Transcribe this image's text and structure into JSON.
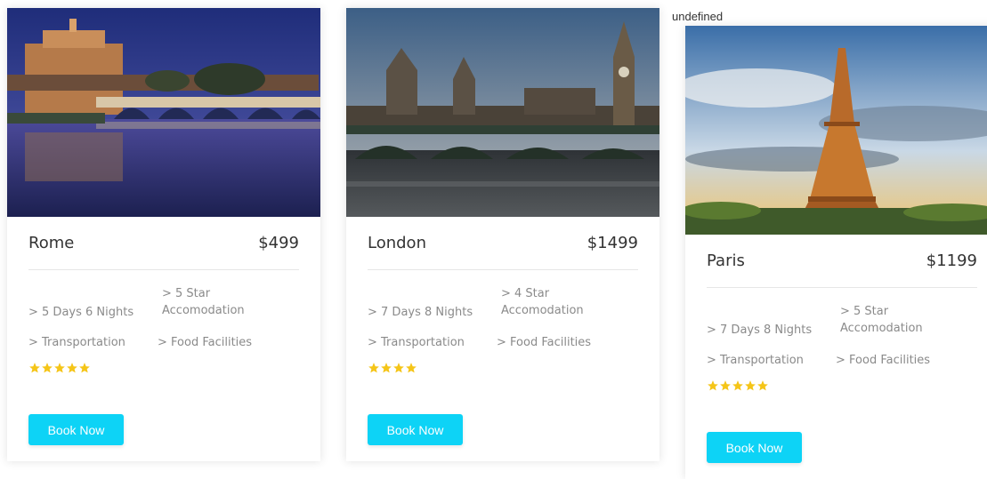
{
  "stray_label": "undefined",
  "colors": {
    "accent": "#0dd3f6",
    "star": "#f5c518",
    "muted_text": "#8a8a8a"
  },
  "cards": [
    {
      "title": "Rome",
      "price": "$499",
      "features": [
        "> 5 Days 6 Nights",
        "> 5 Star Accomodation",
        "> Transportation",
        "> Food Facilities"
      ],
      "rating": 5,
      "button_label": "Book Now"
    },
    {
      "title": "London",
      "price": "$1499",
      "features": [
        "> 7 Days 8 Nights",
        "> 4 Star Accomodation",
        "> Transportation",
        "> Food Facilities"
      ],
      "rating": 4,
      "button_label": "Book Now"
    },
    {
      "title": "Paris",
      "price": "$1199",
      "features": [
        "> 7 Days 8 Nights",
        "> 5 Star Accomodation",
        "> Transportation",
        "> Food Facilities"
      ],
      "rating": 5,
      "button_label": "Book Now"
    }
  ]
}
